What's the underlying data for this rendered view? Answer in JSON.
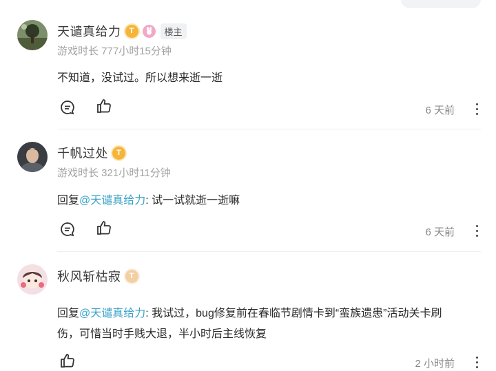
{
  "comments": [
    {
      "author": "天谴真给力",
      "owner_tag": "楼主",
      "level_badge": "T",
      "meta": "游戏时长 777小时15分钟",
      "text": "不知道，没试过。所以想来逝一逝",
      "time": "6 天前"
    },
    {
      "author": "千帆过处",
      "level_badge": "T",
      "meta": "游戏时长 321小时11分钟",
      "reply_prefix": "回复",
      "mention": "@天谴真给力",
      "text": ": 试一试就逝一逝嘛",
      "time": "6 天前"
    },
    {
      "author": "秋风斩枯寂",
      "level_badge": "T",
      "reply_prefix": "回复",
      "mention": "@天谴真给力",
      "text_line1": ": 我试过，bug修复前在春临节剧情卡到“蛮族遗患”活动关卡刷",
      "text_line2": "伤，可惜当时手贱大退，半小时后主线恢复",
      "time": "2 小时前"
    }
  ],
  "icons": {
    "comment": "comment-bubble-icon",
    "like": "thumbs-up-icon",
    "more": "more-vertical-icon"
  },
  "colors": {
    "mention": "#39a3c9",
    "meta": "#a3a3a3",
    "badge_gold": "#f5b53a"
  }
}
